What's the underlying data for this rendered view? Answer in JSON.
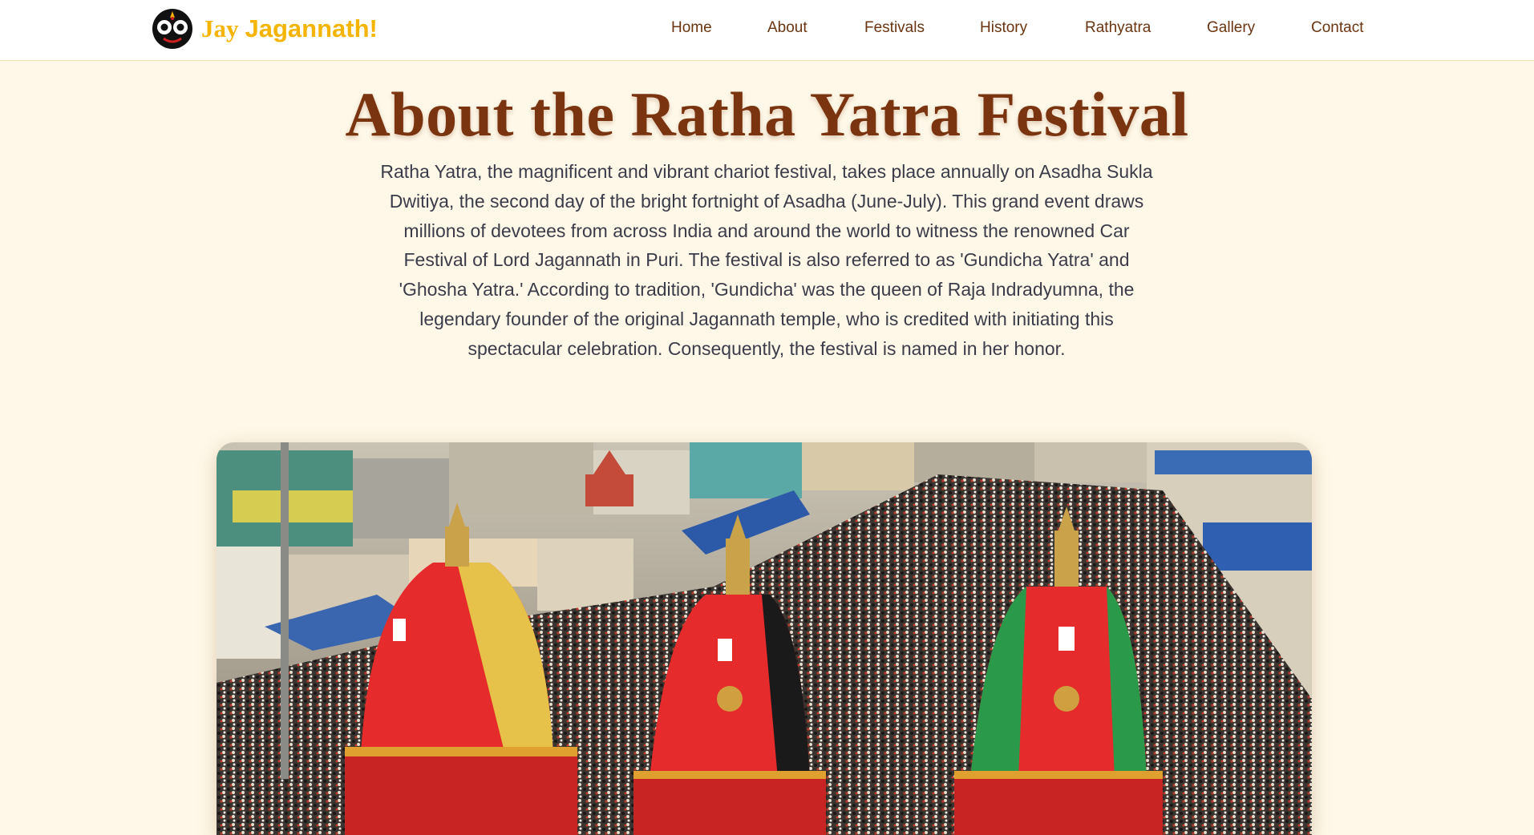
{
  "brand": {
    "jay": "Jay",
    "name": "Jagannath!"
  },
  "nav": {
    "items": [
      "Home",
      "About",
      "Festivals",
      "History",
      "Rathyatra",
      "Gallery",
      "Contact"
    ]
  },
  "main": {
    "title": "About the Ratha Yatra Festival",
    "intro": "Ratha Yatra, the magnificent and vibrant chariot festival, takes place annually on Asadha Sukla Dwitiya, the second day of the bright fortnight of Asadha (June-July). This grand event draws millions of devotees from across India and around the world to witness the renowned Car Festival of Lord Jagannath in Puri. The festival is also referred to as 'Gundicha Yatra' and 'Ghosha Yatra.' According to tradition, 'Gundicha' was the queen of Raja Indradyumna, the legendary founder of the original Jagannath temple, who is credited with initiating this spectacular celebration. Consequently, the festival is named in her honor."
  },
  "colors": {
    "page_background": "#fff8e8",
    "brand": "#f5b400",
    "nav_text": "#6b3410",
    "title": "#7a3410",
    "body_text": "#3b3b4a"
  },
  "icons": {
    "logo": "jagannath-face-icon"
  }
}
